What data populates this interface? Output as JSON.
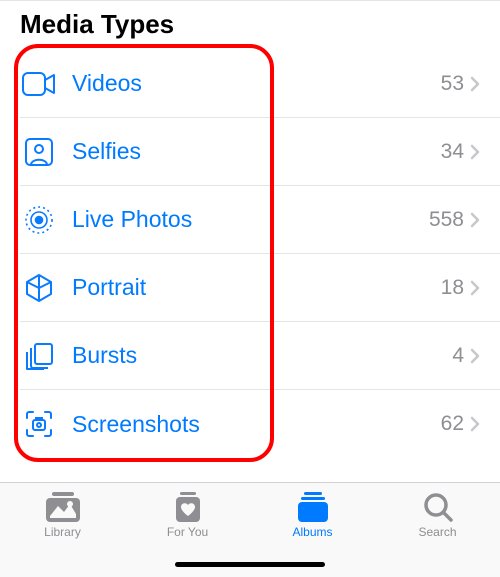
{
  "section": {
    "title": "Media Types",
    "items": [
      {
        "key": "videos",
        "label": "Videos",
        "count": "53",
        "icon": "video-icon"
      },
      {
        "key": "selfies",
        "label": "Selfies",
        "count": "34",
        "icon": "selfies-icon"
      },
      {
        "key": "livephotos",
        "label": "Live Photos",
        "count": "558",
        "icon": "livephotos-icon"
      },
      {
        "key": "portrait",
        "label": "Portrait",
        "count": "18",
        "icon": "portrait-icon"
      },
      {
        "key": "bursts",
        "label": "Bursts",
        "count": "4",
        "icon": "bursts-icon"
      },
      {
        "key": "screenshots",
        "label": "Screenshots",
        "count": "62",
        "icon": "screenshots-icon"
      }
    ]
  },
  "tabs": {
    "library": "Library",
    "foryou": "For You",
    "albums": "Albums",
    "search": "Search"
  },
  "colors": {
    "accent": "#007aff",
    "inactive": "#8e8e93",
    "highlight": "#ff0000"
  }
}
